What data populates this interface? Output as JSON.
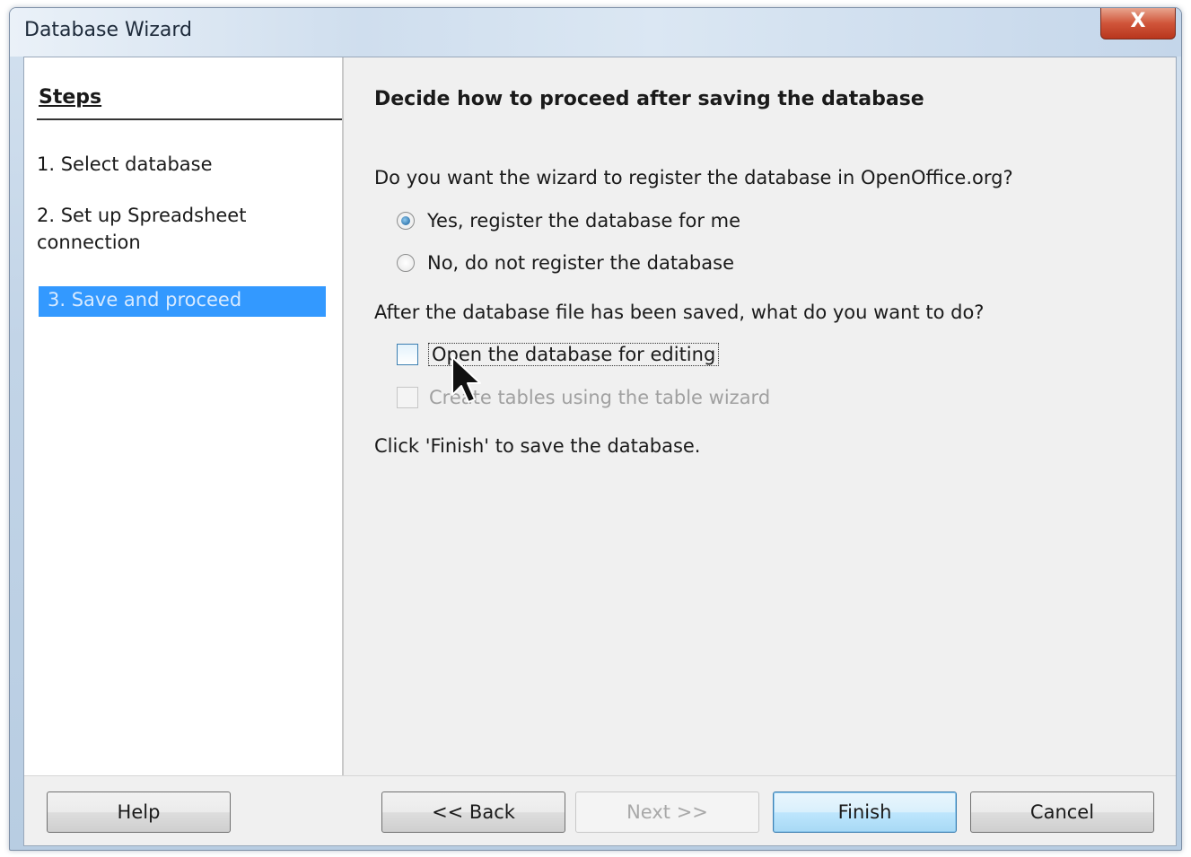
{
  "window": {
    "title": "Database Wizard",
    "close_glyph": "X"
  },
  "steps": {
    "heading": "Steps",
    "items": [
      {
        "label": "1. Select database",
        "active": false
      },
      {
        "label": "2. Set up Spreadsheet connection",
        "active": false
      },
      {
        "label": "3. Save and proceed",
        "active": true
      }
    ]
  },
  "main": {
    "heading": "Decide how to proceed after saving the database",
    "register_question": "Do you want the wizard to register the database in OpenOffice.org?",
    "register_options": [
      {
        "label": "Yes, register the database for me",
        "checked": true
      },
      {
        "label": "No, do not register the database",
        "checked": false
      }
    ],
    "after_save_question": "After the database file has been saved, what do you want to do?",
    "after_save_options": [
      {
        "label": "Open the database for editing",
        "checked": false,
        "enabled": true
      },
      {
        "label": "Create tables using the table wizard",
        "checked": false,
        "enabled": false
      }
    ],
    "finish_hint": "Click 'Finish' to save the database."
  },
  "buttons": {
    "help": "Help",
    "back": "<< Back",
    "next": "Next >>",
    "finish": "Finish",
    "cancel": "Cancel"
  },
  "colors": {
    "selection": "#3399ff",
    "panel_bg": "#f0f0f0"
  },
  "icons": {
    "cursor": "arrow-cursor-icon"
  }
}
